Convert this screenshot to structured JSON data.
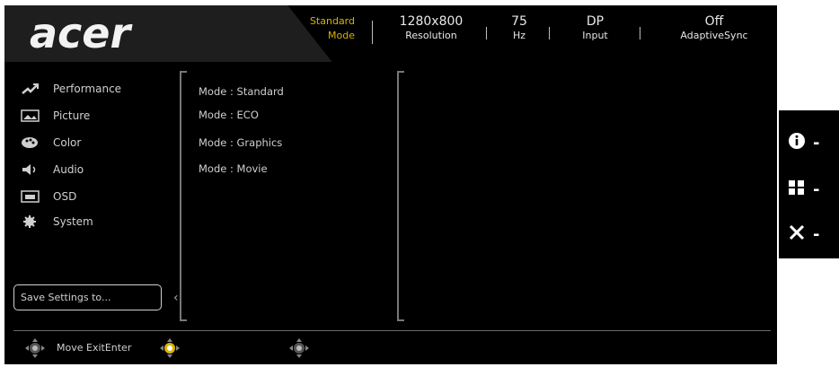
{
  "brand": {
    "logo": "acer"
  },
  "status": {
    "mode_value": "Standard",
    "mode_label": "Mode",
    "resolution_value": "1280x800",
    "resolution_label": "Resolution",
    "hz_value": "75",
    "hz_label": "Hz",
    "input_value": "DP",
    "input_label": "Input",
    "adaptive_value": "Off",
    "adaptive_label": "AdaptiveSync"
  },
  "menu": {
    "items": [
      {
        "label": "Performance",
        "icon": "performance-icon"
      },
      {
        "label": "Picture",
        "icon": "picture-icon"
      },
      {
        "label": "Color",
        "icon": "color-palette-icon"
      },
      {
        "label": "Audio",
        "icon": "speaker-icon"
      },
      {
        "label": "OSD",
        "icon": "osd-icon"
      },
      {
        "label": "System",
        "icon": "gear-icon"
      }
    ],
    "save_label": "Save Settings to..."
  },
  "modes": [
    {
      "label": "Mode : Standard"
    },
    {
      "label": "Mode : ECO"
    },
    {
      "label": "Mode : Graphics"
    },
    {
      "label": "Mode : Movie"
    }
  ],
  "footer": {
    "hint": "Move ExitEnter"
  },
  "colors": {
    "accent": "#d9b300",
    "background": "#000000",
    "text": "#d0d0d0"
  },
  "side_buttons": [
    {
      "icon": "info-icon"
    },
    {
      "icon": "grid-icon"
    },
    {
      "icon": "close-icon"
    }
  ]
}
